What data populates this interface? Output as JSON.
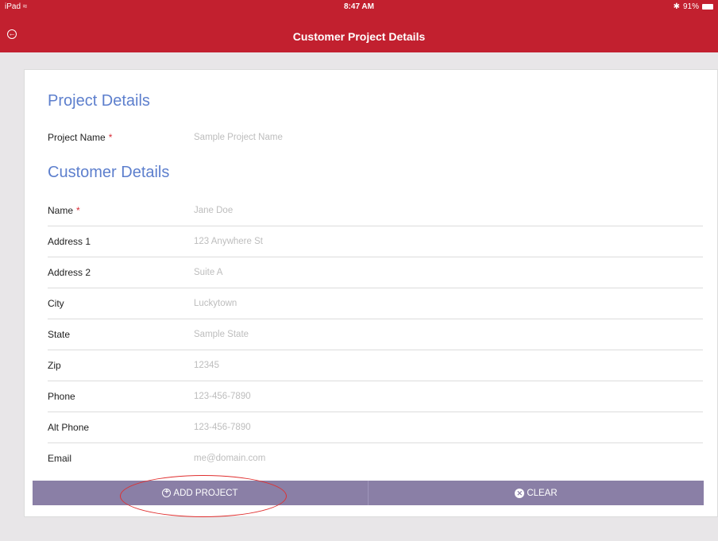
{
  "status_bar": {
    "device": "iPad",
    "wifi_icon": "wifi-icon",
    "time": "8:47 AM",
    "bluetooth": "✱",
    "battery": "91%"
  },
  "nav": {
    "back_icon": "back-circle-icon",
    "title": "Customer Project Details"
  },
  "project_section": {
    "title": "Project Details",
    "fields": [
      {
        "label": "Project Name",
        "required": "*",
        "placeholder": "Sample Project Name"
      }
    ]
  },
  "customer_section": {
    "title": "Customer Details",
    "fields": [
      {
        "label": "Name",
        "required": "*",
        "placeholder": "Jane Doe"
      },
      {
        "label": "Address 1",
        "placeholder": "123 Anywhere St"
      },
      {
        "label": "Address 2",
        "placeholder": "Suite A"
      },
      {
        "label": "City",
        "placeholder": "Luckytown"
      },
      {
        "label": "State",
        "placeholder": "Sample State"
      },
      {
        "label": "Zip",
        "placeholder": "12345"
      },
      {
        "label": "Phone",
        "placeholder": "123-456-7890"
      },
      {
        "label": "Alt Phone",
        "placeholder": "123-456-7890"
      },
      {
        "label": "Email",
        "placeholder": "me@domain.com"
      }
    ]
  },
  "actions": {
    "add_label": "ADD PROJECT",
    "clear_label": "CLEAR"
  },
  "colors": {
    "header": "#c2202f",
    "section_title": "#5d7fcd",
    "button_bar": "#8a7fa6",
    "required": "#d82b36",
    "annotation": "#e03030"
  }
}
